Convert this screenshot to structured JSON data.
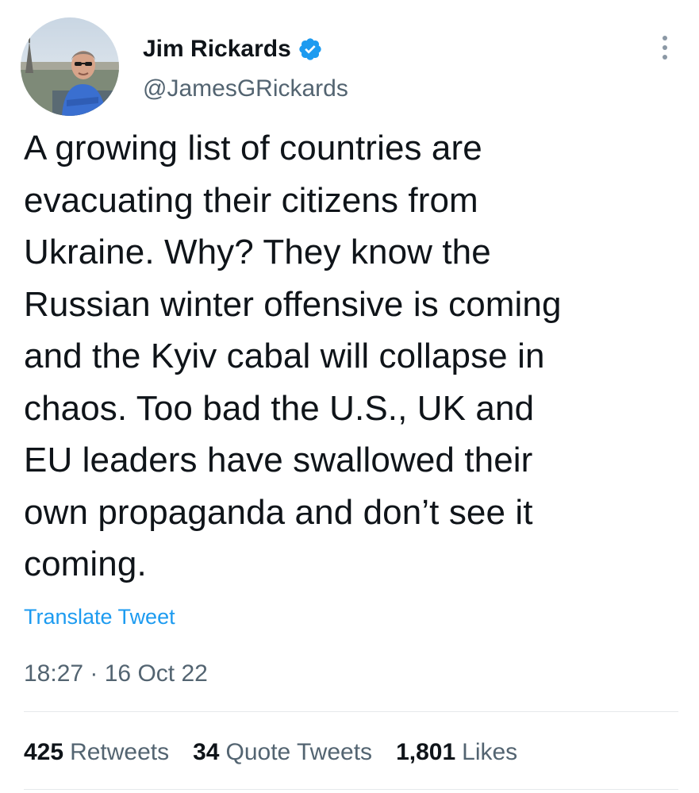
{
  "author": {
    "display_name": "Jim Rickards",
    "handle": "@JamesGRickards",
    "verified_icon": "verified-badge-icon",
    "avatar_icon": "profile-photo"
  },
  "tweet": {
    "lines": [
      "A growing list of countries are",
      "evacuating their citizens from",
      "Ukraine. Why? They know the",
      "Russian winter offensive is coming",
      "and the Kyiv cabal will collapse in",
      "chaos. Too bad the U.S., UK and",
      "EU leaders have swallowed their",
      "own propaganda and don’t see it",
      "coming."
    ],
    "translate_label": "Translate Tweet",
    "timestamp": "18:27 · 16 Oct 22"
  },
  "stats": {
    "retweets": {
      "count": "425",
      "label": "Retweets"
    },
    "quote_tweets": {
      "count": "34",
      "label": "Quote Tweets"
    },
    "likes": {
      "count": "1,801",
      "label": "Likes"
    }
  },
  "colors": {
    "text_primary": "#0f1419",
    "text_secondary": "#536471",
    "link": "#1d9bf0",
    "verified": "#1d9bf0"
  }
}
